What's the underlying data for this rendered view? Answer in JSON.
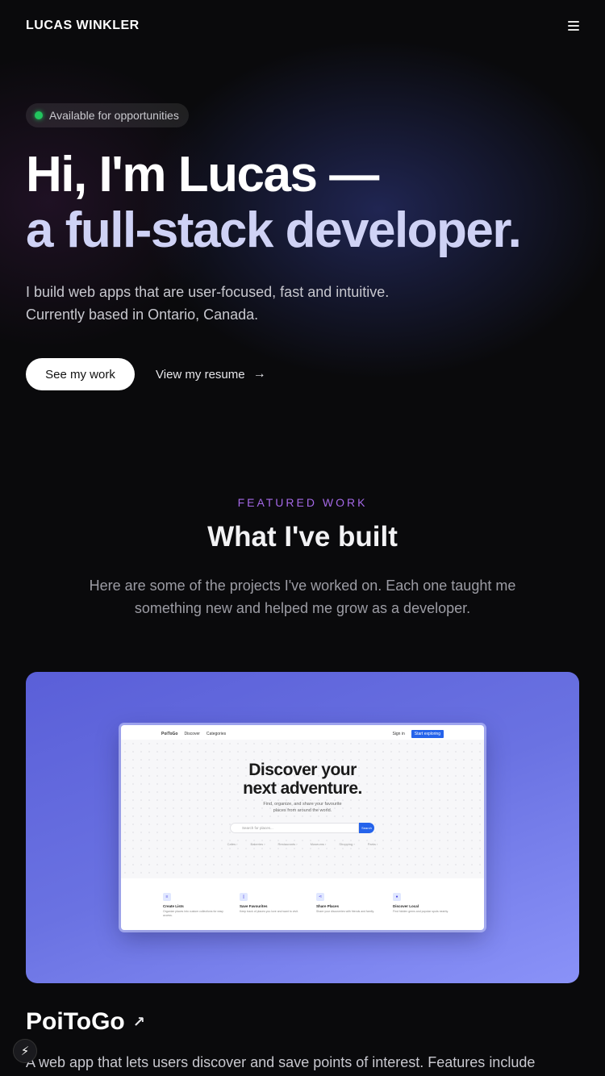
{
  "header": {
    "brand": "LUCAS WINKLER",
    "menu_icon": "hamburger-icon"
  },
  "hero": {
    "badge": "Available for opportunities",
    "headline_line1": "Hi, I'm Lucas —",
    "headline_line2": "a full-stack developer.",
    "intro_line1": "I build web apps that are user-focused, fast and intuitive.",
    "intro_line2": "Currently based in Ontario, Canada.",
    "primary_button": "See my work",
    "secondary_link": "View my resume",
    "arrow": "→"
  },
  "featured": {
    "kicker": "FEATURED WORK",
    "title": "What I've built",
    "description": "Here are some of the projects I've worked on. Each one taught me something new and helped me grow as a developer."
  },
  "project": {
    "name": "PoiToGo",
    "link_icon": "↗",
    "description": "A web app that lets users discover and save points of interest. Features include",
    "mockup": {
      "logo": "PoiToGo",
      "nav": [
        "Discover",
        "Categories"
      ],
      "sign_in": "Sign in",
      "cta": "Start exploring",
      "title_line1": "Discover your",
      "title_line2": "next adventure.",
      "sub_line1": "Find, organize, and share your favourite",
      "sub_line2": "places from around the world.",
      "search_placeholder": "Search for places...",
      "search_button": "Search",
      "categories": [
        "Cafes ›",
        "Bakeries ›",
        "Restaurants ›",
        "Museums ›",
        "Shopping ›",
        "Parks ›"
      ],
      "features": [
        {
          "title": "Create Lists",
          "desc": "Organize places into custom collections for easy access."
        },
        {
          "title": "Save Favourites",
          "desc": "Keep track of places you love and want to visit."
        },
        {
          "title": "Share Places",
          "desc": "Share your discoveries with friends and family."
        },
        {
          "title": "Discover Local",
          "desc": "Find hidden gems and popular spots nearby."
        }
      ]
    }
  },
  "fab_icon": "⚡",
  "colors": {
    "accent": "#a468e6",
    "status": "#22c55e",
    "card_gradient_start": "#5a5fd8",
    "card_gradient_end": "#8a92f8"
  }
}
